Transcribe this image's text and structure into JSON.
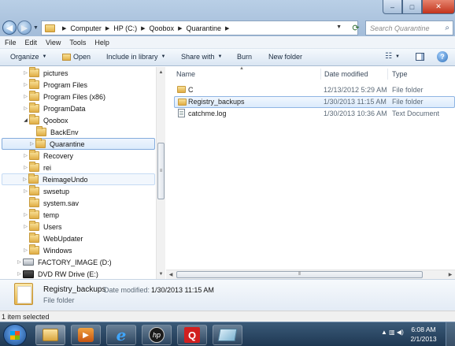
{
  "address_bar": {
    "breadcrumbs": [
      "Computer",
      "HP (C:)",
      "Qoobox",
      "Quarantine"
    ],
    "search_placeholder": "Search Quarantine"
  },
  "menu": [
    "File",
    "Edit",
    "View",
    "Tools",
    "Help"
  ],
  "toolbar": {
    "organize": "Organize",
    "open": "Open",
    "include": "Include in library",
    "share": "Share with",
    "burn": "Burn",
    "new_folder": "New folder"
  },
  "tree": [
    {
      "label": "pictures",
      "type": "folder",
      "expander": "collapsed"
    },
    {
      "label": "Program Files",
      "type": "folder",
      "expander": "collapsed"
    },
    {
      "label": "Program Files (x86)",
      "type": "folder",
      "expander": "collapsed"
    },
    {
      "label": "ProgramData",
      "type": "folder",
      "expander": "collapsed"
    },
    {
      "label": "Qoobox",
      "type": "folder",
      "expander": "expanded"
    },
    {
      "label": "BackEnv",
      "type": "folder",
      "expander": "none"
    },
    {
      "label": "Quarantine",
      "type": "folder",
      "expander": "collapsed"
    },
    {
      "label": "Recovery",
      "type": "folder",
      "expander": "collapsed"
    },
    {
      "label": "rei",
      "type": "folder",
      "expander": "collapsed"
    },
    {
      "label": "ReimageUndo",
      "type": "folder",
      "expander": "collapsed"
    },
    {
      "label": "swsetup",
      "type": "folder",
      "expander": "collapsed"
    },
    {
      "label": "system.sav",
      "type": "folder",
      "expander": "none"
    },
    {
      "label": "temp",
      "type": "folder",
      "expander": "collapsed"
    },
    {
      "label": "Users",
      "type": "folder",
      "expander": "collapsed"
    },
    {
      "label": "WebUpdater",
      "type": "folder",
      "expander": "none"
    },
    {
      "label": "Windows",
      "type": "folder",
      "expander": "collapsed"
    },
    {
      "label": "FACTORY_IMAGE (D:)",
      "type": "drive",
      "expander": "collapsed"
    },
    {
      "label": "DVD RW Drive (E:)",
      "type": "dvd",
      "expander": "collapsed"
    }
  ],
  "columns": {
    "name": "Name",
    "date": "Date modified",
    "type": "Type"
  },
  "files": [
    {
      "name": "C",
      "date": "12/13/2012 5:29 AM",
      "type": "File folder",
      "icon": "folder-icon"
    },
    {
      "name": "Registry_backups",
      "date": "1/30/2013 11:15 AM",
      "type": "File folder",
      "icon": "folder-icon"
    },
    {
      "name": "catchme.log",
      "date": "1/30/2013 10:36 AM",
      "type": "Text Document",
      "icon": "text-document-icon"
    }
  ],
  "details": {
    "name": "Registry_backups",
    "date_label": "Date modified:",
    "date_value": "1/30/2013 11:15 AM",
    "type": "File folder"
  },
  "status": "1 item selected",
  "clock": {
    "time": "6:08 AM",
    "date": "2/1/2013"
  },
  "colors": {
    "title_bar": "#b9cfe6",
    "selection": "#dcebfc",
    "selection_border": "#84acdd",
    "taskbar": "#1f3853"
  }
}
